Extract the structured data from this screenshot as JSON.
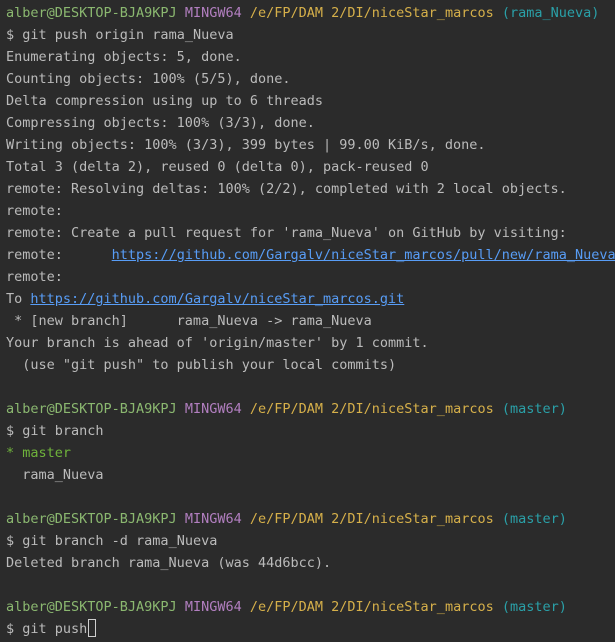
{
  "prompt": {
    "user_host": "alber@DESKTOP-BJA9KPJ",
    "shell": "MINGW64",
    "path": "/e/FP/DAM 2/DI/niceStar_marcos",
    "branch_nueva": "(rama_Nueva)",
    "branch_master": "(master)",
    "ps": "$ "
  },
  "block1": {
    "command": "git push origin rama_Nueva",
    "lines": [
      "Enumerating objects: 5, done.",
      "Counting objects: 100% (5/5), done.",
      "Delta compression using up to 6 threads",
      "Compressing objects: 100% (3/3), done.",
      "Writing objects: 100% (3/3), 399 bytes | 99.00 KiB/s, done.",
      "Total 3 (delta 2), reused 0 (delta 0), pack-reused 0",
      "remote: Resolving deltas: 100% (2/2), completed with 2 local objects.",
      "remote:",
      "remote: Create a pull request for 'rama_Nueva' on GitHub by visiting:"
    ],
    "remote_prefix": "remote:      ",
    "pull_url": "https://github.com/Gargalv/niceStar_marcos/pull/new/rama_Nueva",
    "remote_end": "remote:",
    "to_prefix": "To ",
    "repo_url": "https://github.com/Gargalv/niceStar_marcos.git",
    "tail": [
      " * [new branch]      rama_Nueva -> rama_Nueva",
      "Your branch is ahead of 'origin/master' by 1 commit.",
      "  (use \"git push\" to publish your local commits)"
    ]
  },
  "block2": {
    "command": "git branch",
    "current_branch": "* master",
    "other_branch": "  rama_Nueva"
  },
  "block3": {
    "command": "git branch -d rama_Nueva",
    "output": "Deleted branch rama_Nueva (was 44d6bcc)."
  },
  "block4": {
    "command": "git push"
  }
}
